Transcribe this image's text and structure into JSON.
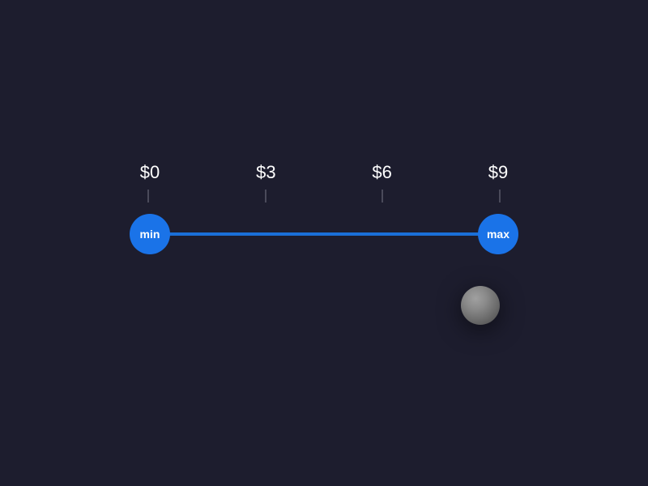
{
  "slider": {
    "ticks": [
      {
        "label": "$0"
      },
      {
        "label": "$3"
      },
      {
        "label": "$6"
      },
      {
        "label": "$9"
      }
    ],
    "min_handle_label": "min",
    "max_handle_label": "max",
    "min_value": 0,
    "max_value": 9,
    "current_min": 0,
    "current_max": 9
  }
}
